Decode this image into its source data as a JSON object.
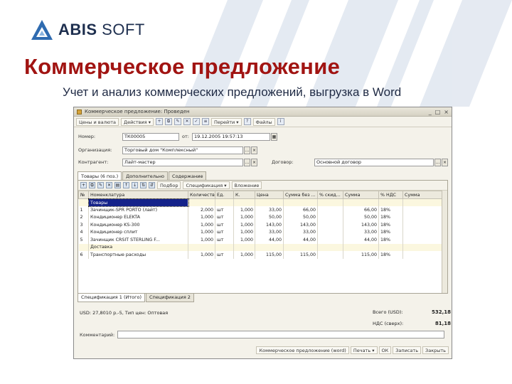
{
  "brand": {
    "name_bold": "ABIS",
    "name_rest": " SOFT",
    "logo_color": "#2f6bb0"
  },
  "slide": {
    "title": "Коммерческое предложение",
    "subtitle": "Учет и анализ коммерческих предложений, выгрузка в Word",
    "title_color": "#a11412"
  },
  "window": {
    "title": "Коммерческое предложение: Проведен",
    "controls": [
      "_",
      "□",
      "×"
    ],
    "toolbar": {
      "price_type": "Цены и валюта",
      "actions": "Действия ▾",
      "goto": "Перейти ▾",
      "files": "Файлы"
    },
    "header": {
      "number_label": "Номер:",
      "number_value": "ТК00005",
      "date_label": "от:",
      "date_value": "19.12.2005 19:57:13",
      "org_label": "Организация:",
      "org_value": "Торговый дом \"Комплексный\"",
      "contractor_label": "Контрагент:",
      "contractor_value": "Лайт-мастер",
      "contract_label": "Договор:",
      "contract_value": "Основной договор"
    },
    "tabs": [
      "Товары (6 поз.)",
      "Дополнительно",
      "Содержание"
    ],
    "subtoolbar": {
      "pick": "Подбор",
      "spec": "Спецификация ▾",
      "enclosure": "Вложение"
    },
    "columns": [
      "№",
      "Номенклатура",
      "Количество",
      "Ед.",
      "К.",
      "Цена",
      "Сумма без ...",
      "% скид...",
      "Сумма",
      "% НДС",
      "Сумма"
    ],
    "groups": {
      "goods": "Товары",
      "delivery": "Доставка"
    },
    "rows": [
      {
        "n": "1",
        "item": "Зачинщик-SPR PORTO (лайт)",
        "qty": "2,000",
        "unit": "шт",
        "k": "1,000",
        "price": "33,00",
        "sum_wo": "66,00",
        "disc": "",
        "sum": "66,00",
        "vat": "18%"
      },
      {
        "n": "2",
        "item": "Кондиционер ELEKTA",
        "qty": "1,000",
        "unit": "шт",
        "k": "1,000",
        "price": "50,00",
        "sum_wo": "50,00",
        "disc": "",
        "sum": "50,00",
        "vat": "18%"
      },
      {
        "n": "3",
        "item": "Кондиционер KS-300",
        "qty": "1,000",
        "unit": "шт",
        "k": "1,000",
        "price": "143,00",
        "sum_wo": "143,00",
        "disc": "",
        "sum": "143,00",
        "vat": "18%"
      },
      {
        "n": "4",
        "item": "Кондиционер сплит",
        "qty": "1,000",
        "unit": "шт",
        "k": "1,000",
        "price": "33,00",
        "sum_wo": "33,00",
        "disc": "",
        "sum": "33,00",
        "vat": "18%"
      },
      {
        "n": "5",
        "item": "Зачинщик CRSIT STERLING F...",
        "qty": "1,000",
        "unit": "шт",
        "k": "1,000",
        "price": "44,00",
        "sum_wo": "44,00",
        "disc": "",
        "sum": "44,00",
        "vat": "18%"
      },
      {
        "n": "6",
        "item": "Транспортные расходы",
        "qty": "1,000",
        "unit": "шт",
        "k": "1,000",
        "price": "115,00",
        "sum_wo": "115,00",
        "disc": "",
        "sum": "115,00",
        "vat": "18%"
      }
    ],
    "spec_tabs": [
      "Спецификация 1 (Итого)",
      "Спецификация 2"
    ],
    "totals": {
      "rate_text": "USD: 27,8010 р.-5, Тип цен: Оптовая",
      "total_label": "Всего (USD):",
      "total_value": "532,18",
      "vat_label": "НДС (сверх):",
      "vat_value": "81,18"
    },
    "comment_label": "Комментарий:",
    "footer": {
      "print_form": "Коммерческое предложение (word)",
      "print": "Печать ▾",
      "ok": "ОК",
      "save": "Записать",
      "close": "Закрыть"
    }
  }
}
